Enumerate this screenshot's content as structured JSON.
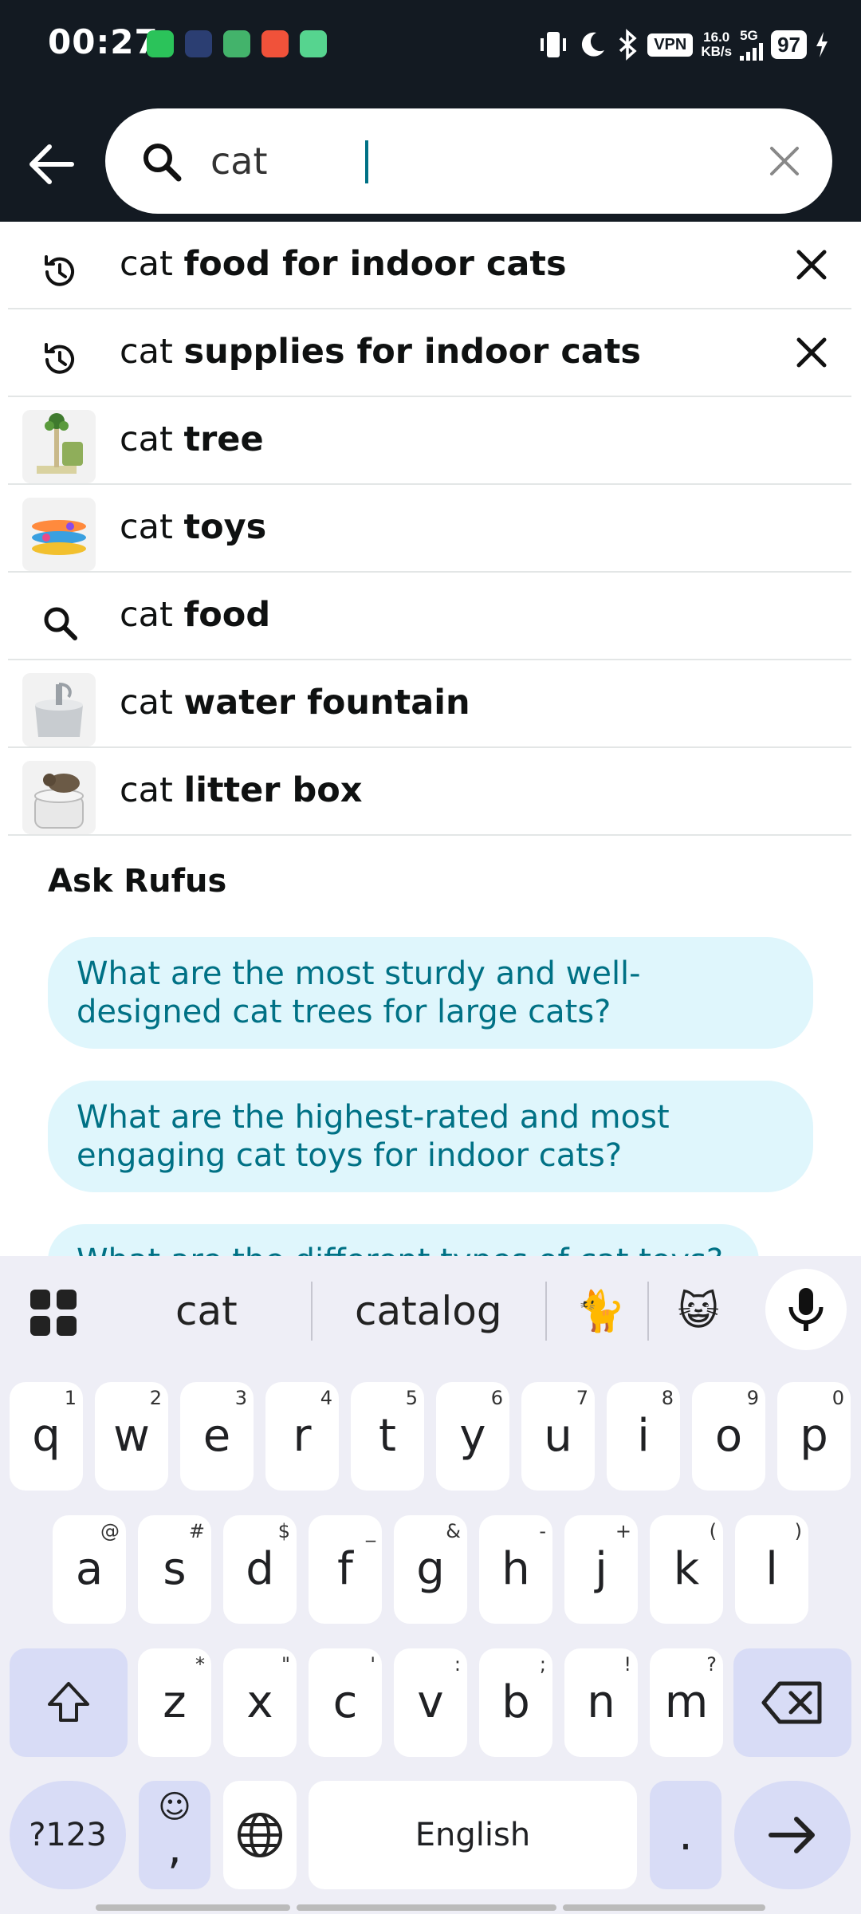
{
  "status_bar": {
    "time": "00:27",
    "vpn": "VPN",
    "speed_value": "16.0",
    "speed_unit": "KB/s",
    "network": "5G",
    "battery": "97"
  },
  "search": {
    "query": "cat"
  },
  "suggestions": [
    {
      "prefix": "cat",
      "suffix": "food for indoor cats",
      "type": "history",
      "removable": true
    },
    {
      "prefix": "cat",
      "suffix": "supplies for indoor cats",
      "type": "history",
      "removable": true
    },
    {
      "prefix": "cat",
      "suffix": "tree",
      "type": "product-image"
    },
    {
      "prefix": "cat",
      "suffix": "toys",
      "type": "product-image"
    },
    {
      "prefix": "cat",
      "suffix": "food",
      "type": "search"
    },
    {
      "prefix": "cat",
      "suffix": "water fountain",
      "type": "product-image"
    },
    {
      "prefix": "cat",
      "suffix": "litter box",
      "type": "product-image"
    }
  ],
  "rufus": {
    "title": "Ask Rufus",
    "chips": [
      {
        "line1": "What are the most sturdy and well-",
        "line2": "designed cat trees for large cats?"
      },
      {
        "line1": "What are the highest-rated and most",
        "line2": "engaging cat toys for indoor cats?"
      },
      {
        "line1": "What are the different types of cat toys?",
        "line2": ""
      }
    ]
  },
  "keyboard": {
    "suggestions": [
      "cat",
      "catalog",
      "🐈",
      "😺"
    ],
    "row1": [
      {
        "k": "q",
        "s": "1"
      },
      {
        "k": "w",
        "s": "2"
      },
      {
        "k": "e",
        "s": "3"
      },
      {
        "k": "r",
        "s": "4"
      },
      {
        "k": "t",
        "s": "5"
      },
      {
        "k": "y",
        "s": "6"
      },
      {
        "k": "u",
        "s": "7"
      },
      {
        "k": "i",
        "s": "8"
      },
      {
        "k": "o",
        "s": "9"
      },
      {
        "k": "p",
        "s": "0"
      }
    ],
    "row2": [
      {
        "k": "a",
        "s": "@"
      },
      {
        "k": "s",
        "s": "#"
      },
      {
        "k": "d",
        "s": "$"
      },
      {
        "k": "f",
        "s": "_"
      },
      {
        "k": "g",
        "s": "&"
      },
      {
        "k": "h",
        "s": "-"
      },
      {
        "k": "j",
        "s": "+"
      },
      {
        "k": "k",
        "s": "("
      },
      {
        "k": "l",
        "s": ")"
      }
    ],
    "row3": [
      {
        "k": "z",
        "s": "*"
      },
      {
        "k": "x",
        "s": "\""
      },
      {
        "k": "c",
        "s": "'"
      },
      {
        "k": "v",
        "s": ":"
      },
      {
        "k": "b",
        "s": ";"
      },
      {
        "k": "n",
        "s": "!"
      },
      {
        "k": "m",
        "s": "?"
      }
    ],
    "symbols_label": "?123",
    "comma": ",",
    "space_label": "English",
    "period": "."
  },
  "colors": {
    "header_bg": "#131a22",
    "rufus_chip_bg": "#dff6fc",
    "rufus_text": "#007185",
    "keyboard_bg": "#eeeef6",
    "modifier_key": "#d8dcf6"
  }
}
